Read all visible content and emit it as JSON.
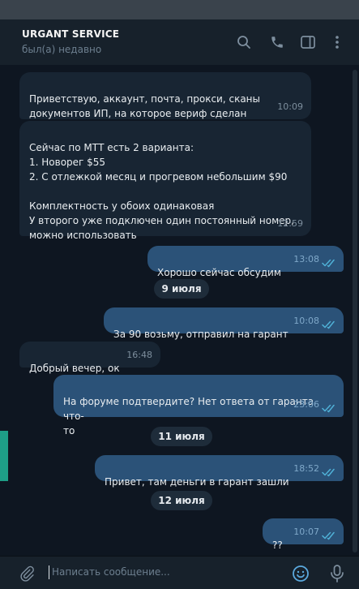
{
  "header": {
    "title": "URGANT SERVICE",
    "status": "был(а) недавно",
    "icons": [
      "search-icon",
      "phone-icon",
      "sidebar-toggle-icon",
      "more-vertical-icon"
    ]
  },
  "messages": [
    {
      "direction": "in",
      "text": "Приветствую, аккаунт, почта, прокси, сканы\nдокументов ИП, на которое вериф сделан",
      "time": "10:09"
    },
    {
      "direction": "in",
      "text": "Сейчас по МТТ есть 2 варианта:\n1. Новорег $55\n2. С отлежкой месяц и прогревом небольшим $90\n\nКомплектность у обоих одинаковая\nУ второго уже подключен один постоянный номер,\nможно использовать",
      "time": "12:59"
    },
    {
      "direction": "out",
      "text": "Хорошо сейчас обсудим",
      "time": "13:08",
      "read": true
    },
    {
      "direction": "out",
      "text": "За 90 возьму, отправил на гарант",
      "time": "10:08",
      "read": true
    },
    {
      "direction": "in",
      "text": "Добрый вечер, ок",
      "time": "16:48"
    },
    {
      "direction": "out",
      "text": "На форуме подтвердите? Нет ответа от гаранта что-\nто",
      "time": "23:06",
      "read": true
    },
    {
      "direction": "out",
      "text": "Привет, там деньги в гарант зашли",
      "time": "18:52",
      "read": true
    },
    {
      "direction": "out",
      "text": "??",
      "time": "10:07",
      "read": true
    }
  ],
  "dates": [
    "9 июля",
    "11 июля",
    "12 июля"
  ],
  "input": {
    "placeholder": "Написать сообщение...",
    "icons": [
      "attach-icon",
      "emoji-icon",
      "microphone-icon"
    ]
  },
  "colors": {
    "header_bg": "#17212b",
    "chat_bg": "#0e1621",
    "incoming_bubble": "#182533",
    "outgoing_bubble": "#2b5278",
    "read_check": "#4fb0d6",
    "accent": "#1e9e87"
  }
}
